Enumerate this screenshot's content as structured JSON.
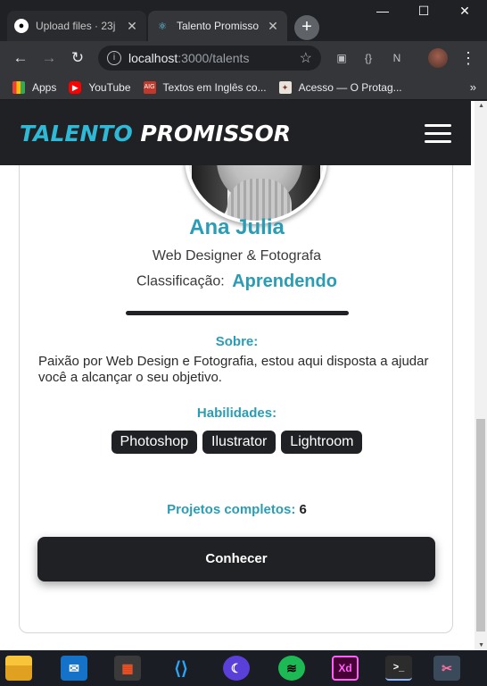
{
  "browser": {
    "tabs": [
      {
        "title": "Upload files · 23j",
        "active": false,
        "icon": "github-icon"
      },
      {
        "title": "Talento Promisso",
        "active": true,
        "icon": "react-icon"
      }
    ],
    "url_host": "localhost",
    "url_path": ":3000/talents",
    "bookmarks": [
      {
        "label": "Apps",
        "icon": "apps-grid-icon"
      },
      {
        "label": "YouTube",
        "icon": "youtube-icon"
      },
      {
        "label": "Textos em Inglês co...",
        "icon": "aig-icon"
      },
      {
        "label": "Acesso — O Protag...",
        "icon": "compass-icon"
      }
    ]
  },
  "app": {
    "brand_part1": "TALENTO",
    "brand_part2": "PROMISSOR"
  },
  "profile": {
    "name": "Ana Julia",
    "role": "Web Designer & Fotografa",
    "class_label": "Classificação:",
    "class_value": "Aprendendo",
    "about_title": "Sobre:",
    "about_text": "Paixão por Web Design e Fotografia, estou aqui disposta a ajudar você a alcançar o seu objetivo.",
    "skills_title": "Habilidades:",
    "skills": [
      "Photoshop",
      "Ilustrator",
      "Lightroom"
    ],
    "projects_label": "Projetos completos:",
    "projects_count": "6",
    "cta_label": "Conhecer"
  },
  "colors": {
    "accent": "#2a9db5",
    "dark": "#202124"
  },
  "taskbar": [
    "file-explorer-icon",
    "mail-icon",
    "store-icon",
    "vscode-icon",
    "notion-moon-icon",
    "spotify-icon",
    "adobe-xd-icon",
    "terminal-icon",
    "snip-tool-icon"
  ]
}
